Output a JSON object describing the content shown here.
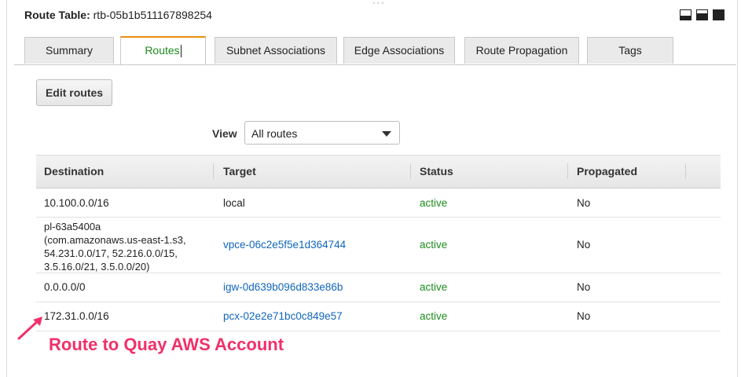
{
  "header": {
    "label": "Route Table:",
    "value": "rtb-05b1b511167898254",
    "grip": "°°°"
  },
  "window_icons": [
    "minimize-icon",
    "restore-icon",
    "maximize-icon"
  ],
  "tabs": [
    {
      "label": "Summary"
    },
    {
      "label": "Routes"
    },
    {
      "label": "Subnet Associations"
    },
    {
      "label": "Edge Associations"
    },
    {
      "label": "Route Propagation"
    },
    {
      "label": "Tags"
    }
  ],
  "active_tab": "Routes",
  "edit_button": "Edit routes",
  "view": {
    "label": "View",
    "selected": "All routes"
  },
  "table": {
    "columns": [
      "Destination",
      "Target",
      "Status",
      "Propagated"
    ],
    "rows": [
      {
        "destination": "10.100.0.0/16",
        "target": "local",
        "status": "active",
        "propagated": "No"
      },
      {
        "destination": "pl-63a5400a\n(com.amazonaws.us-east-1.s3,\n54.231.0.0/17, 52.216.0.0/15,\n3.5.16.0/21, 3.5.0.0/20)",
        "target": "vpce-06c2e5f5e1d364744",
        "status": "active",
        "propagated": "No"
      },
      {
        "destination": "0.0.0.0/0",
        "target": "igw-0d639b096d833e86b",
        "status": "active",
        "propagated": "No"
      },
      {
        "destination": "172.31.0.0/16",
        "target": "pcx-02e2e71bc0c849e57",
        "status": "active",
        "propagated": "No"
      }
    ]
  },
  "annotation": "Route to Quay AWS Account",
  "colors": {
    "accent_tab": "#e8900c",
    "link": "#1166bb",
    "status_active": "#1d8d1d",
    "annotation": "#f0306a"
  }
}
